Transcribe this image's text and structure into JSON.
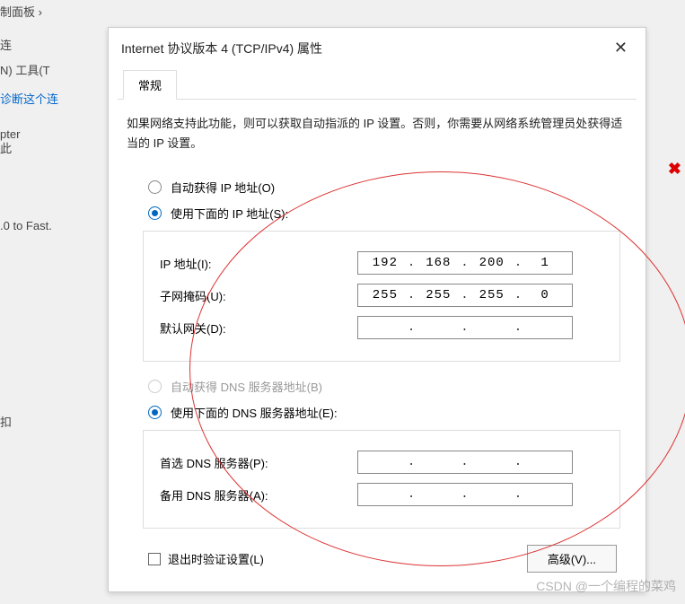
{
  "background": {
    "frag1": "制面板  ›",
    "frag2": "N)   工具(T",
    "frag3": "诊断这个连",
    "frag4": "pter",
    "frag5": ".0 to Fast.",
    "frag6": "连",
    "frag7": "此",
    "frag8": "扣"
  },
  "dialog": {
    "title": "Internet 协议版本 4 (TCP/IPv4) 属性",
    "tab": "常规",
    "description": "如果网络支持此功能，则可以获取自动指派的 IP 设置。否则，你需要从网络系统管理员处获得适当的 IP 设置。",
    "ip": {
      "auto_label": "自动获得 IP 地址(O)",
      "manual_label": "使用下面的 IP 地址(S):",
      "addr_label": "IP 地址(I):",
      "addr": {
        "a": "192",
        "b": "168",
        "c": "200",
        "d": "1"
      },
      "mask_label": "子网掩码(U):",
      "mask": {
        "a": "255",
        "b": "255",
        "c": "255",
        "d": "0"
      },
      "gw_label": "默认网关(D):",
      "gw": {
        "a": "",
        "b": "",
        "c": "",
        "d": ""
      }
    },
    "dns": {
      "auto_label": "自动获得 DNS 服务器地址(B)",
      "manual_label": "使用下面的 DNS 服务器地址(E):",
      "pref_label": "首选 DNS 服务器(P):",
      "pref": {
        "a": "",
        "b": "",
        "c": "",
        "d": ""
      },
      "alt_label": "备用 DNS 服务器(A):",
      "alt": {
        "a": "",
        "b": "",
        "c": "",
        "d": ""
      }
    },
    "validate_label": "退出时验证设置(L)",
    "advanced_label": "高级(V)..."
  },
  "watermark": "CSDN @一个编程的菜鸡"
}
